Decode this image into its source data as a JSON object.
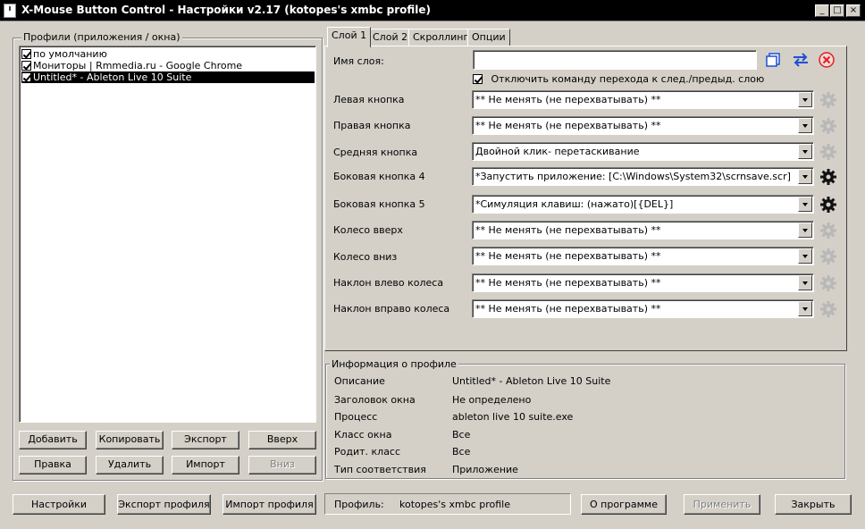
{
  "window": {
    "title": "X-Mouse Button Control - Настройки v2.17 (kotopes's xmbc profile)",
    "minimize": "_",
    "maximize": "□",
    "close": "×"
  },
  "profiles": {
    "group_label": "Профили (приложения / окна)",
    "items": [
      {
        "label": "по умолчанию",
        "checked": true,
        "selected": false
      },
      {
        "label": "Мониторы | Rmmedia.ru - Google Chrome",
        "checked": true,
        "selected": false
      },
      {
        "label": "Untitled* - Ableton Live 10 Suite",
        "checked": true,
        "selected": true
      }
    ],
    "buttons": {
      "add": "Добавить",
      "copy": "Копировать",
      "export": "Экспорт",
      "up": "Вверх",
      "edit": "Правка",
      "delete": "Удалить",
      "import": "Импорт",
      "down": "Вниз"
    }
  },
  "tabs": [
    "Слой 1",
    "Слой 2",
    "Скроллинг",
    "Опции"
  ],
  "layer": {
    "name_label": "Имя слоя:",
    "name_value": "",
    "disable_switch_label": "Отключить команду перехода к след./предыд. слою",
    "rows": [
      {
        "label": "Левая кнопка",
        "value": "** Не менять (не перехватывать) **",
        "gear_active": false
      },
      {
        "label": "Правая кнопка",
        "value": "** Не менять (не перехватывать) **",
        "gear_active": false
      },
      {
        "label": "Средняя кнопка",
        "value": "Двойной клик- перетаскивание",
        "gear_active": false
      },
      {
        "label": "Боковая кнопка 4",
        "value": "*Запустить приложение: [C:\\Windows\\System32\\scrnsave.scr]",
        "gear_active": true
      },
      {
        "label": "Боковая кнопка 5",
        "value": "*Симуляция клавиш: (нажато)[{DEL}]",
        "gear_active": true
      },
      {
        "label": "Колесо вверх",
        "value": "** Не менять (не перехватывать) **",
        "gear_active": false
      },
      {
        "label": "Колесо вниз",
        "value": "** Не менять (не перехватывать) **",
        "gear_active": false
      },
      {
        "label": "Наклон влево колеса",
        "value": "** Не менять (не перехватывать) **",
        "gear_active": false
      },
      {
        "label": "Наклон вправо колеса",
        "value": "** Не менять (не перехватывать) **",
        "gear_active": false
      }
    ]
  },
  "info": {
    "group_label": "Информация о профиле",
    "rows": [
      {
        "label": "Описание",
        "value": "Untitled* - Ableton Live 10 Suite"
      },
      {
        "label": "Заголовок окна",
        "value": "Не определено"
      },
      {
        "label": "Процесс",
        "value": "ableton live 10 suite.exe"
      },
      {
        "label": "Класс окна",
        "value": "Все"
      },
      {
        "label": "Родит. класс",
        "value": "Все"
      },
      {
        "label": "Тип соответствия",
        "value": "Приложение"
      }
    ]
  },
  "bottom": {
    "settings": "Настройки",
    "export_profile": "Экспорт профиля",
    "import_profile": "Импорт профиля",
    "profile_label": "Профиль:",
    "profile_value": "kotopes's xmbc profile",
    "about": "О программе",
    "apply": "Применить",
    "close": "Закрыть"
  },
  "colors": {
    "accent_blue": "#1f4fd6",
    "delete_red": "#e02020",
    "face": "#d4d0c8"
  }
}
